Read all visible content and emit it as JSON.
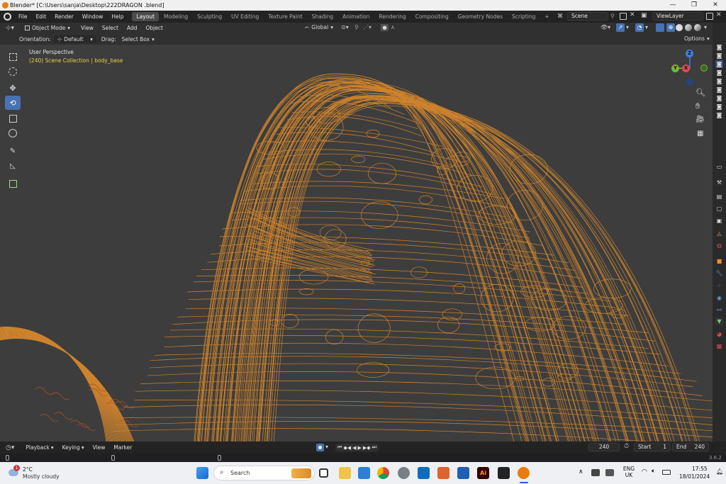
{
  "window": {
    "title": "Blender* [C:\\Users\\sanja\\Desktop\\222DRAGON .blend]",
    "controls": [
      "—",
      "❐",
      "✕"
    ]
  },
  "topbar": {
    "menus": [
      "File",
      "Edit",
      "Render",
      "Window",
      "Help"
    ],
    "workspaces": [
      "Layout",
      "Modeling",
      "Sculpting",
      "UV Editing",
      "Texture Paint",
      "Shading",
      "Animation",
      "Rendering",
      "Compositing",
      "Geometry Nodes",
      "Scripting"
    ],
    "active_workspace": "Layout",
    "add_tab": "+",
    "scene": "Scene",
    "view_layer": "ViewLayer"
  },
  "viewport_header": {
    "mode": "Object Mode",
    "menus": [
      "View",
      "Select",
      "Add",
      "Object"
    ],
    "transform_orientation": "Global"
  },
  "tool_header": {
    "orientation_label": "Orientation:",
    "orientation_value": "Default",
    "drag_label": "Drag:",
    "drag_value": "Select Box",
    "options": "Options"
  },
  "viewport": {
    "view_name": "User Perspective",
    "collection_info": "(240) Scene Collection | body_base",
    "wire_color": "#e8902a",
    "bg_color": "#3d3d3d",
    "gizmo": {
      "x": "X",
      "y": "Y",
      "z": "Z",
      "x_color": "#e04a5a",
      "y_color": "#7bb33a",
      "z_color": "#3f7fe0"
    }
  },
  "toolbar": {
    "tools": [
      "select-box",
      "cursor",
      "move",
      "rotate",
      "scale",
      "transform",
      "annotate",
      "measure",
      "add-cube"
    ],
    "active_tool": "rotate"
  },
  "timeline": {
    "menus": [
      "Playback",
      "Keying",
      "View",
      "Marker"
    ],
    "current_frame": "240",
    "start_label": "Start",
    "start_value": "1",
    "end_label": "End",
    "end_value": "240"
  },
  "statusbar": {
    "version": "3.6.2"
  },
  "taskbar": {
    "weather_temp": "2°C",
    "weather_desc": "Mostly cloudy",
    "weather_badge": "1",
    "search_placeholder": "Search",
    "lang_line1": "ENG",
    "lang_line2": "UK",
    "time": "17:55",
    "date": "18/01/2024"
  }
}
